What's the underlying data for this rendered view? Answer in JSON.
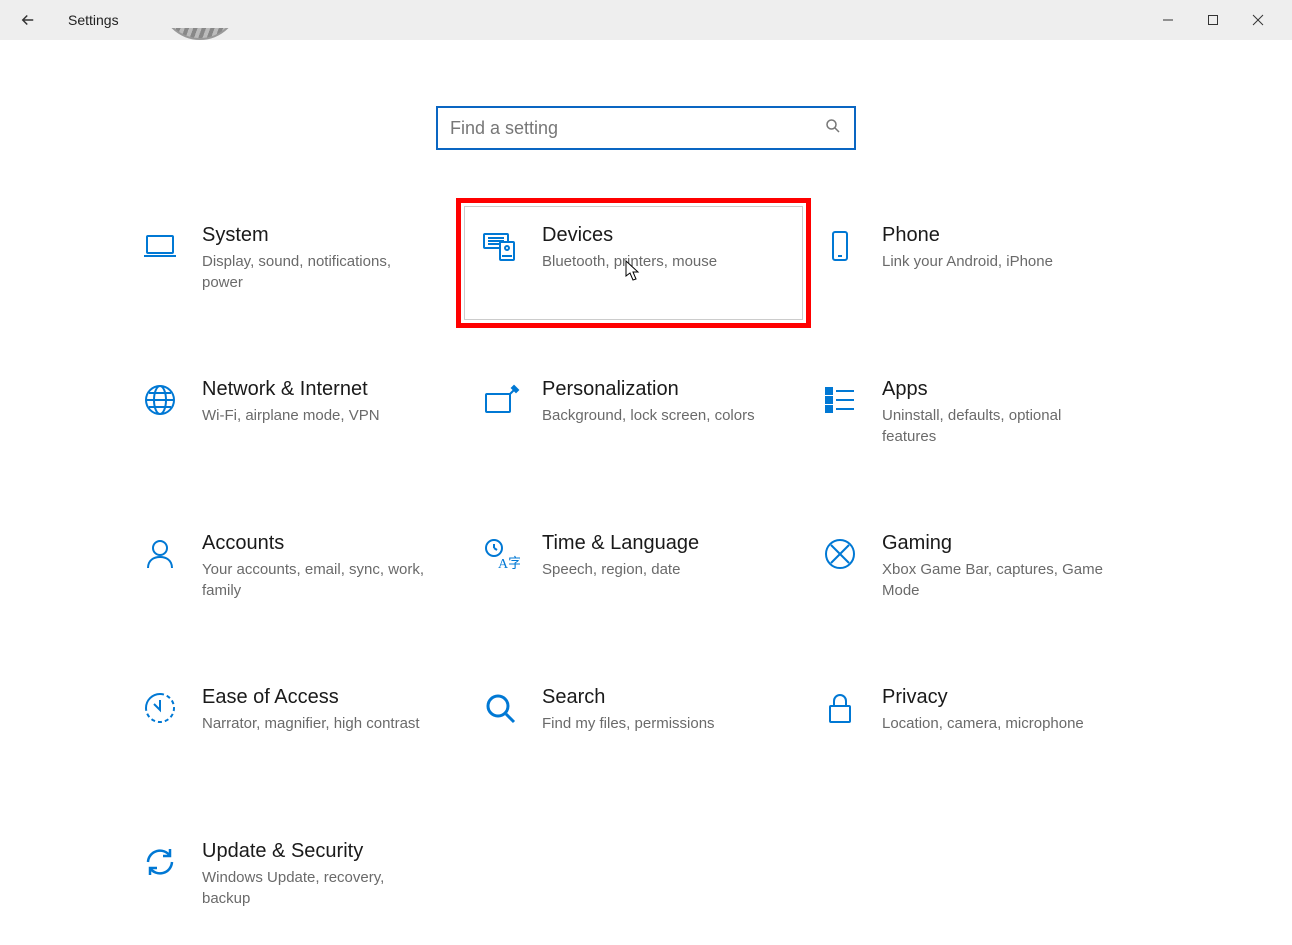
{
  "app": {
    "title": "Settings"
  },
  "search": {
    "placeholder": "Find a setting"
  },
  "tiles": {
    "system": {
      "title": "System",
      "desc": "Display, sound, notifications, power"
    },
    "devices": {
      "title": "Devices",
      "desc": "Bluetooth, printers, mouse"
    },
    "phone": {
      "title": "Phone",
      "desc": "Link your Android, iPhone"
    },
    "network": {
      "title": "Network & Internet",
      "desc": "Wi-Fi, airplane mode, VPN"
    },
    "personalization": {
      "title": "Personalization",
      "desc": "Background, lock screen, colors"
    },
    "apps": {
      "title": "Apps",
      "desc": "Uninstall, defaults, optional features"
    },
    "accounts": {
      "title": "Accounts",
      "desc": "Your accounts, email, sync, work, family"
    },
    "time": {
      "title": "Time & Language",
      "desc": "Speech, region, date"
    },
    "gaming": {
      "title": "Gaming",
      "desc": "Xbox Game Bar, captures, Game Mode"
    },
    "ease": {
      "title": "Ease of Access",
      "desc": "Narrator, magnifier, high contrast"
    },
    "searchtile": {
      "title": "Search",
      "desc": "Find my files, permissions"
    },
    "privacy": {
      "title": "Privacy",
      "desc": "Location, camera, microphone"
    },
    "update": {
      "title": "Update & Security",
      "desc": "Windows Update, recovery, backup"
    }
  }
}
